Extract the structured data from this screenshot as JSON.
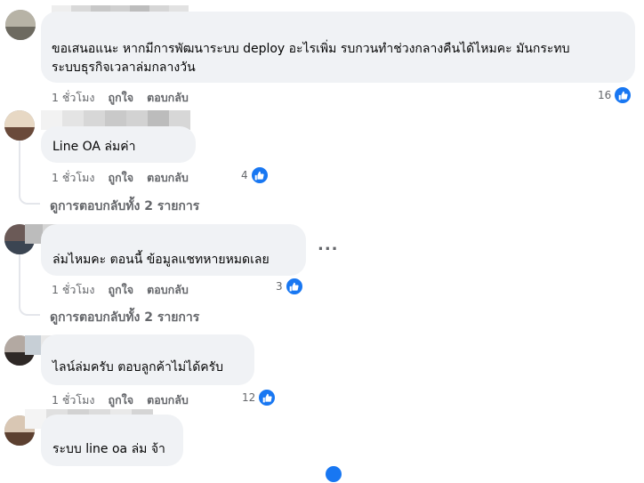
{
  "colors": {
    "like_blue": "#1877f2",
    "bubble_bg": "#f0f2f5",
    "meta_gray": "#65676b"
  },
  "comments": [
    {
      "text_line1": "ขอเสนอแนะ หากมีการพัฒนาระบบ deploy อะไรเพิ่ม รบกวนทำช่วงกลางคืนได้ไหมคะ มันกระทบ",
      "text_line2": "ระบบธุรกิจเวลาล่มกลางวัน",
      "time": "1 ชั่วโมง",
      "like": "ถูกใจ",
      "reply": "ตอบกลับ",
      "reactions": "16"
    },
    {
      "text_line1": "Line OA ล่มค่า",
      "time": "1 ชั่วโมง",
      "like": "ถูกใจ",
      "reply": "ตอบกลับ",
      "reactions": "4",
      "view_replies": "ดูการตอบกลับทั้ง 2 รายการ"
    },
    {
      "text_line1": "ล่มไหมคะ ตอนนี้ ข้อมูลแชทหายหมดเลย",
      "time": "1 ชั่วโมง",
      "like": "ถูกใจ",
      "reply": "ตอบกลับ",
      "reactions": "3",
      "view_replies": "ดูการตอบกลับทั้ง 2 รายการ",
      "more": "..."
    },
    {
      "text_line1": "ไลน์ล่มครับ ตอบลูกค้าไม่ได้ครับ",
      "time": "1 ชั่วโมง",
      "like": "ถูกใจ",
      "reply": "ตอบกลับ",
      "reactions": "12"
    },
    {
      "text_line1": "ระบบ line oa ล่ม จ้า"
    }
  ]
}
